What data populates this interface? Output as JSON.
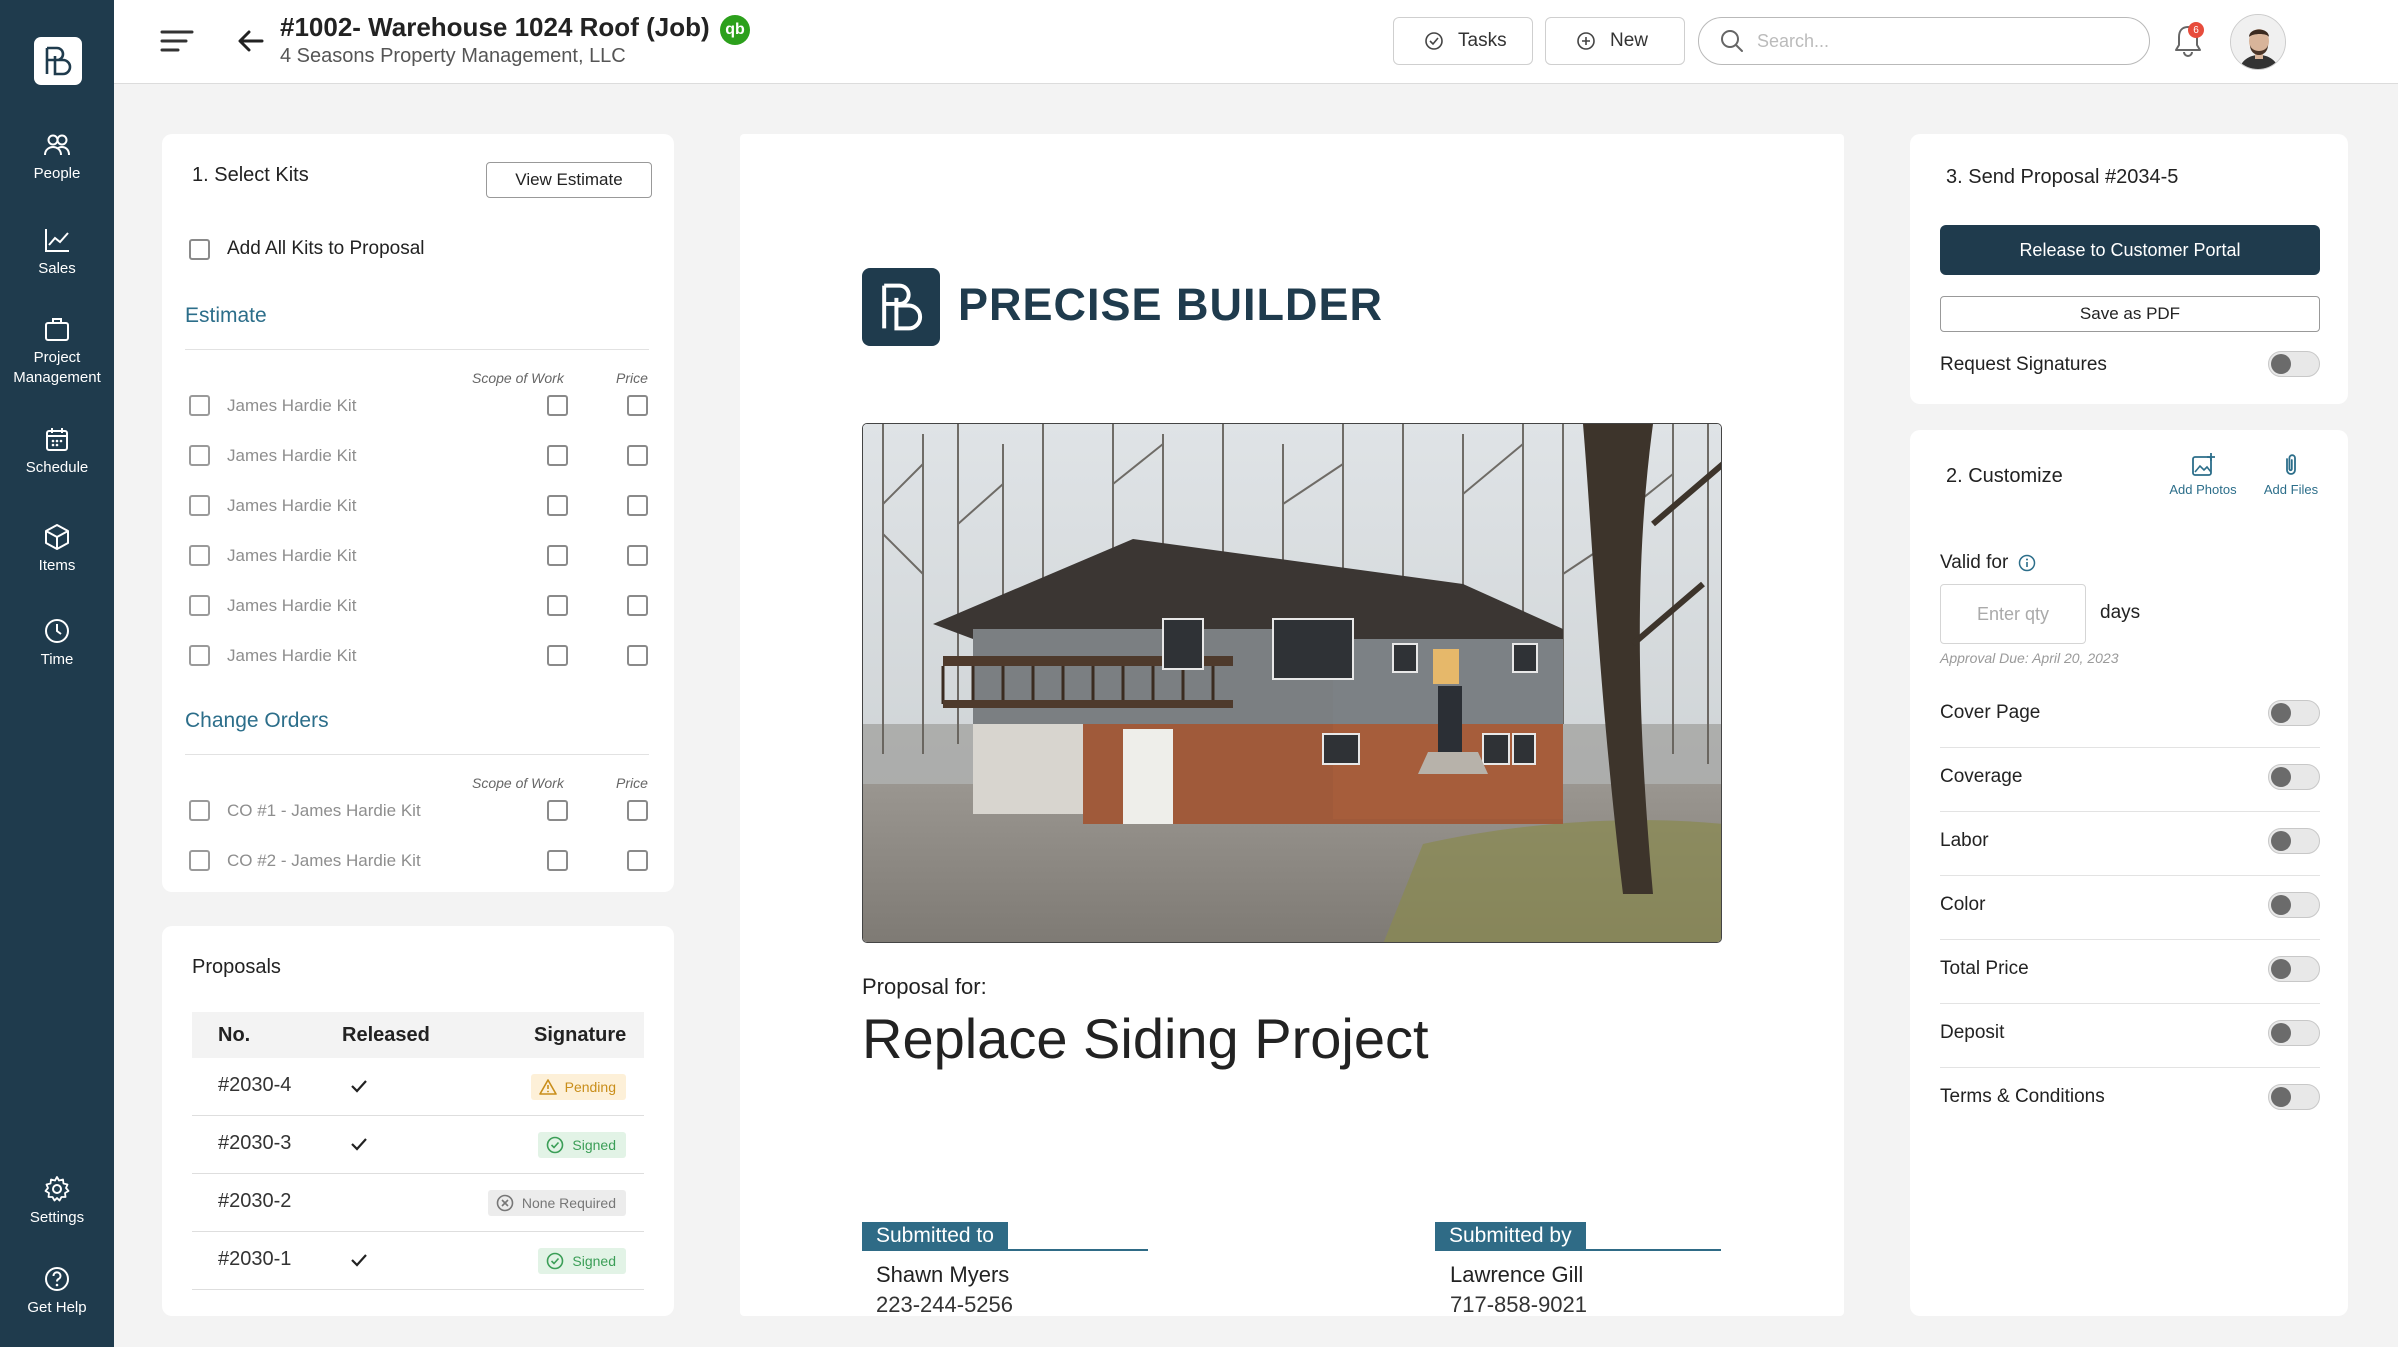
{
  "sidebar": {
    "items": [
      {
        "label": "People",
        "icon": "people-icon"
      },
      {
        "label": "Sales",
        "icon": "chart-line-icon"
      },
      {
        "label": "Project Management",
        "icon": "briefcase-icon"
      },
      {
        "label": "Schedule",
        "icon": "calendar-icon"
      },
      {
        "label": "Items",
        "icon": "cube-icon"
      },
      {
        "label": "Time",
        "icon": "clock-icon"
      }
    ],
    "settings": "Settings",
    "help": "Get Help"
  },
  "header": {
    "title": "#1002- Warehouse 1024 Roof (Job)",
    "subtitle": "4 Seasons Property Management, LLC",
    "qb_badge": "qb",
    "tasks": "Tasks",
    "new": "New",
    "search_placeholder": "Search...",
    "notification_count": "6"
  },
  "kits": {
    "title": "1. Select Kits",
    "view_estimate": "View Estimate",
    "add_all": "Add All Kits to Proposal",
    "estimate_heading": "Estimate",
    "col_scope": "Scope of Work",
    "col_price": "Price",
    "estimate_items": [
      "James Hardie Kit",
      "James Hardie Kit",
      "James Hardie Kit",
      "James Hardie Kit",
      "James Hardie Kit",
      "James Hardie Kit"
    ],
    "change_orders_heading": "Change Orders",
    "change_orders": [
      "CO #1  - James Hardie Kit",
      "CO #2  - James Hardie Kit"
    ]
  },
  "proposals": {
    "title": "Proposals",
    "headers": [
      "No.",
      "Released",
      "Signature"
    ],
    "rows": [
      {
        "no": "#2030-4",
        "released": true,
        "signature": "Pending",
        "status": "pending"
      },
      {
        "no": "#2030-3",
        "released": true,
        "signature": "Signed",
        "status": "signed"
      },
      {
        "no": "#2030-2",
        "released": false,
        "signature": "None Required",
        "status": "none"
      },
      {
        "no": "#2030-1",
        "released": true,
        "signature": "Signed",
        "status": "signed"
      }
    ]
  },
  "document": {
    "brand": "PRECISE BUILDER",
    "proposal_for": "Proposal for:",
    "project_title": "Replace Siding Project",
    "submitted_to_label": "Submitted to",
    "submitted_to_name": "Shawn Myers",
    "submitted_to_phone": "223-244-5256",
    "submitted_by_label": "Submitted by",
    "submitted_by_name": "Lawrence Gill",
    "submitted_by_phone": "717-858-9021"
  },
  "send": {
    "title": "3. Send Proposal #2034-5",
    "release": "Release to Customer Portal",
    "save_pdf": "Save as PDF",
    "request_signatures": "Request Signatures"
  },
  "customize": {
    "title": "2. Customize",
    "add_photos": "Add Photos",
    "add_files": "Add Files",
    "valid_for": "Valid for",
    "qty_placeholder": "Enter qty",
    "days": "days",
    "approval_due": "Approval Due: April 20, 2023",
    "options": [
      "Cover Page",
      "Coverage",
      "Labor",
      "Color",
      "Total Price",
      "Deposit",
      "Terms & Conditions"
    ]
  },
  "colors": {
    "sidebar": "#1f3b4d",
    "accent": "#2c6e8a",
    "quickbooks": "#2ca01c"
  }
}
